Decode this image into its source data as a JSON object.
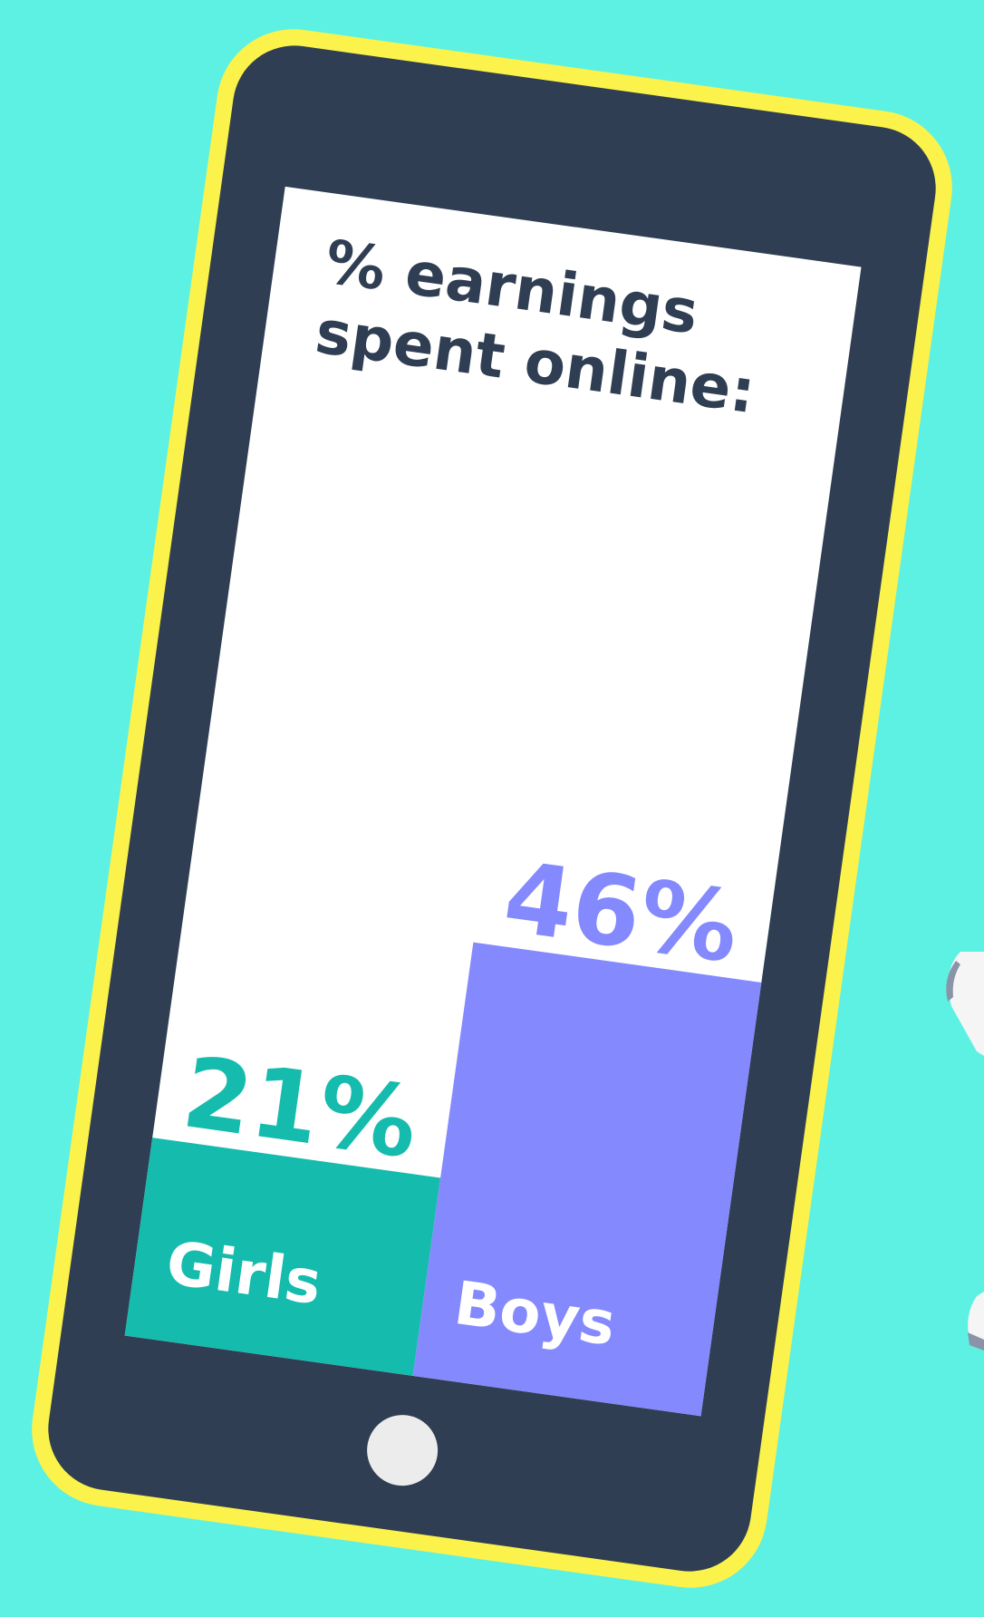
{
  "chart_data": {
    "type": "bar",
    "title_lines": [
      "% earnings",
      "spent online:"
    ],
    "categories": [
      "Girls",
      "Boys"
    ],
    "values": [
      21,
      46
    ],
    "value_labels": [
      "21%",
      "46%"
    ],
    "unit": "%",
    "ylim": [
      0,
      100
    ],
    "colors": [
      "#15bbad",
      "#8489fd"
    ]
  },
  "colors": {
    "background": "#5df1e3",
    "phone_border": "#fbf34b",
    "phone_body": "#2f3e52",
    "screen": "#ffffff",
    "title_text": "#2f3e52",
    "home_button": "#ececec"
  }
}
